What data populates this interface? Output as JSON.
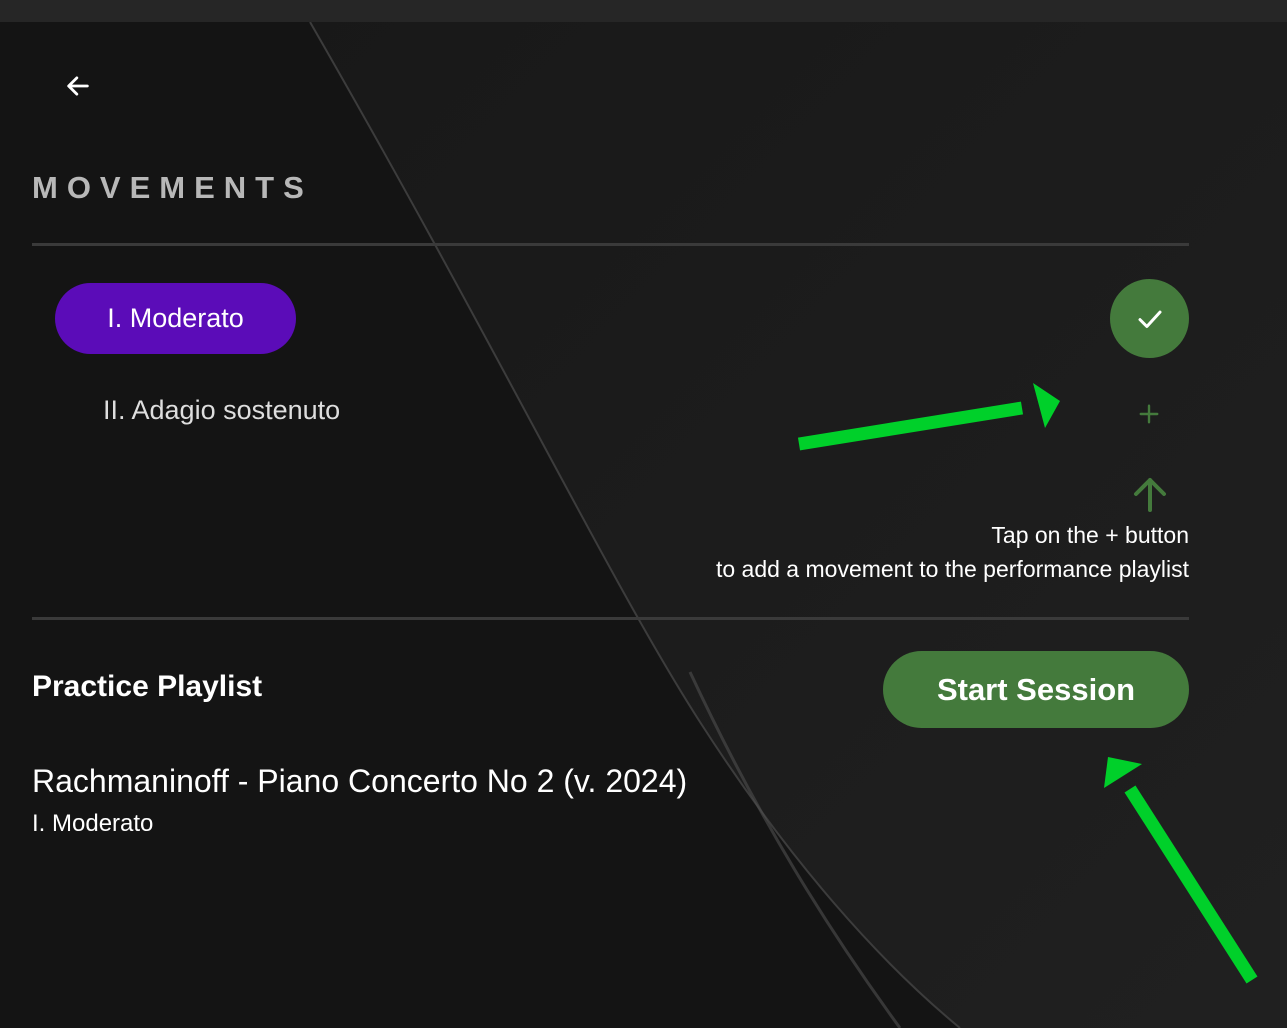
{
  "header": {
    "back_icon": "arrow-left-icon"
  },
  "movements": {
    "section_title": "MOVEMENTS",
    "items": [
      {
        "label": "I. Moderato",
        "selected": true,
        "action_icon": "check-icon"
      },
      {
        "label": "II. Adagio sostenuto",
        "selected": false,
        "action_icon": "plus-icon"
      }
    ],
    "hint_icon": "arrow-up-icon",
    "hint_line1": "Tap on the + button",
    "hint_line2": "to add a movement to the performance playlist"
  },
  "playlist": {
    "title": "Practice Playlist",
    "start_button_label": "Start Session",
    "entries": [
      {
        "piece": "Rachmaninoff - Piano Concerto No 2 (v. 2024)",
        "movement": "I. Moderato"
      }
    ]
  },
  "colors": {
    "background": "#141414",
    "accent_purple": "#5b0cb8",
    "accent_green": "#447a3c",
    "annotation_green": "#00d02a",
    "divider": "#3a3a3a"
  }
}
